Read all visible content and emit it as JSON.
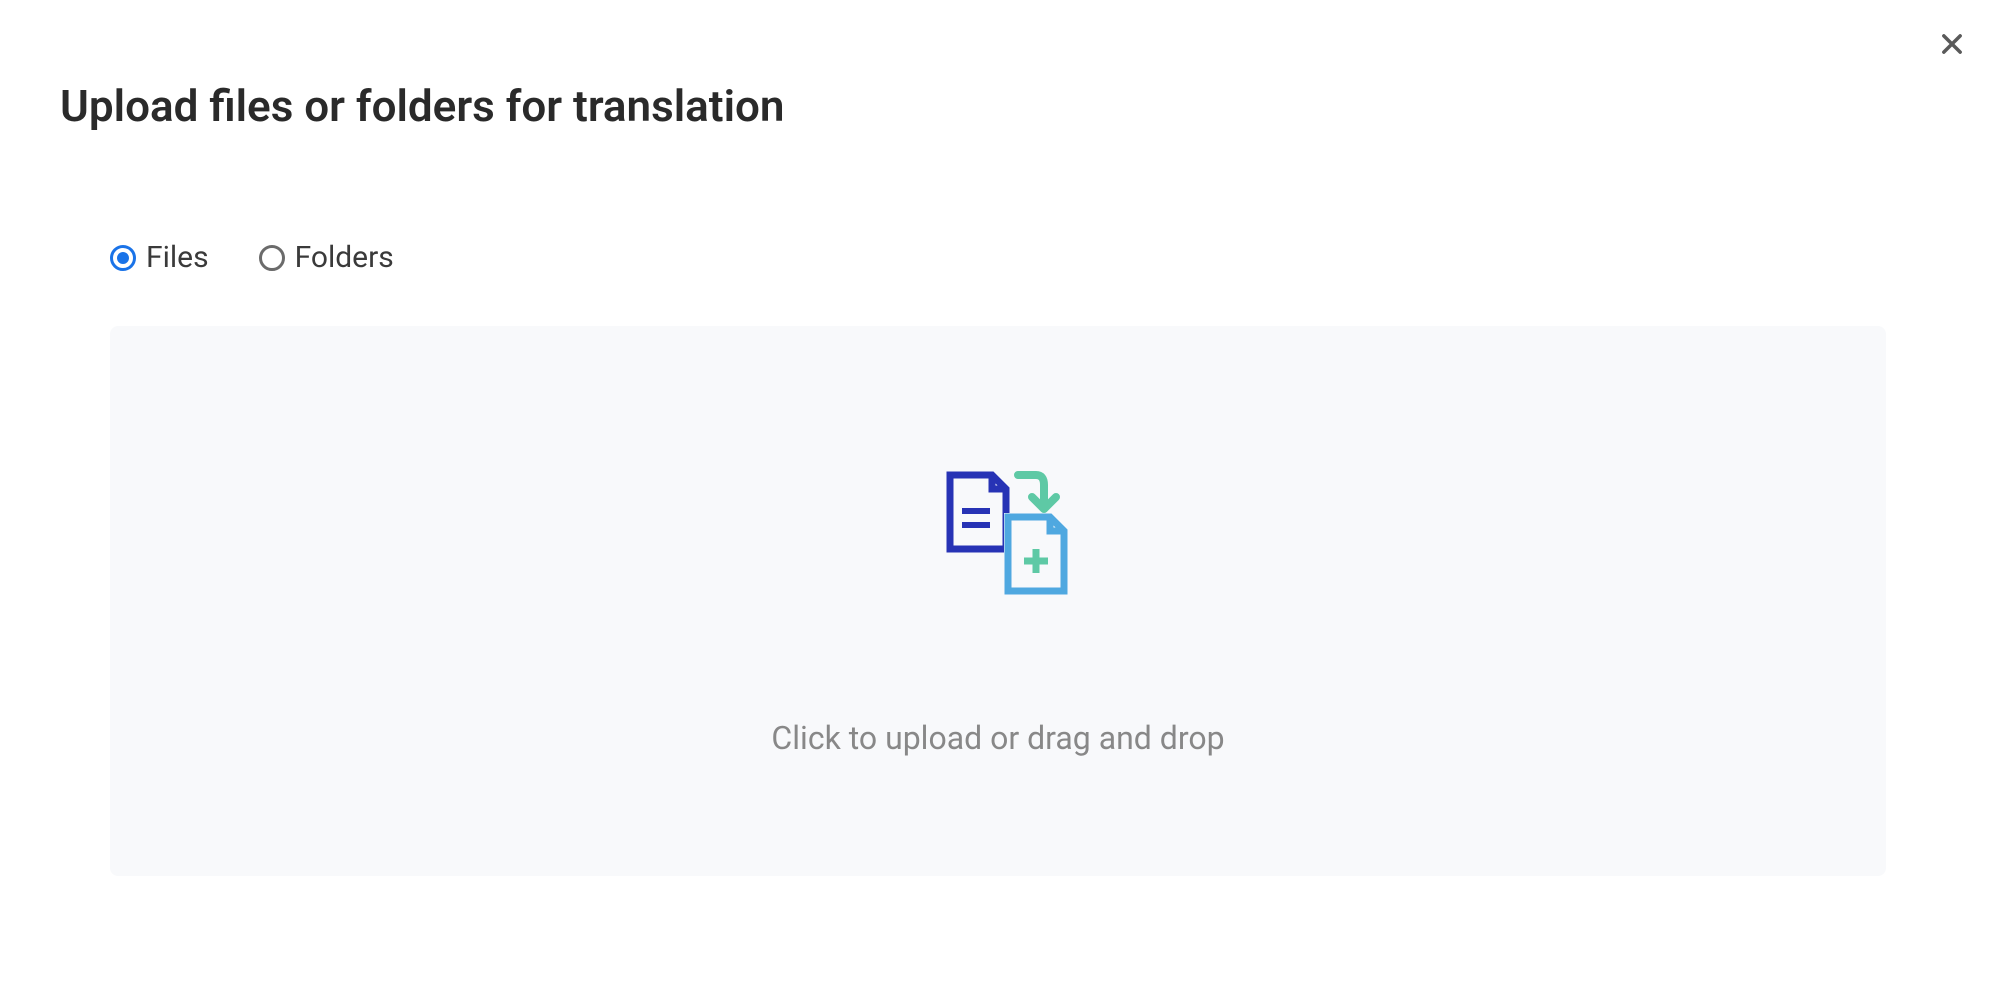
{
  "modal": {
    "title": "Upload files or folders for translation",
    "close_label": "Close"
  },
  "upload_mode": {
    "selected": "files",
    "options": {
      "files": {
        "label": "Files"
      },
      "folders": {
        "label": "Folders"
      }
    }
  },
  "dropzone": {
    "instruction": "Click to upload or drag and drop"
  }
}
